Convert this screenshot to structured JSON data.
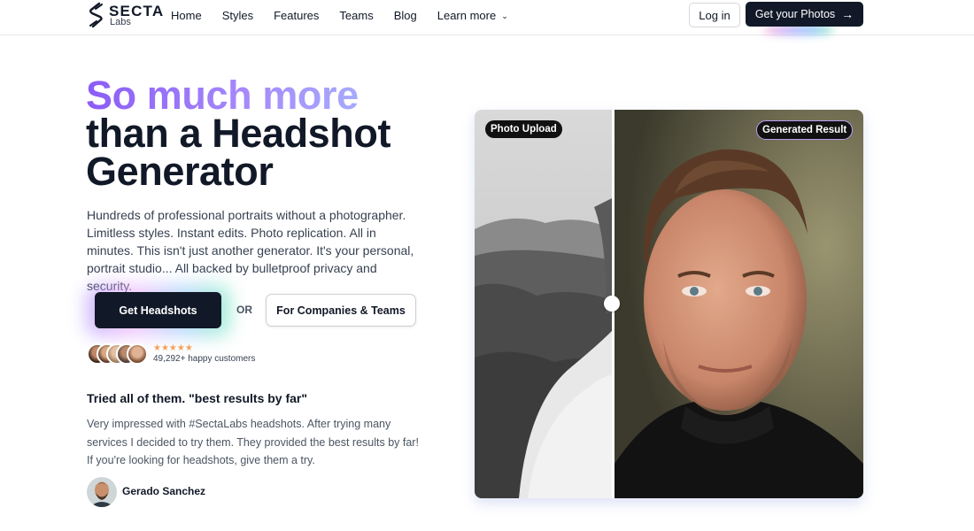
{
  "nav": {
    "brand_main": "SECTA",
    "brand_sub": "Labs",
    "links": [
      "Home",
      "Styles",
      "Features",
      "Teams",
      "Blog",
      "Learn more"
    ],
    "login_label": "Log in",
    "cta_label": "Get your Photos"
  },
  "hero": {
    "headline_gradient": "So much more",
    "headline_line2": "than a Headshot",
    "headline_line3": "Generator",
    "subcopy": "Hundreds of professional portraits without a photographer. Limitless styles. Instant edits. Photo replication. All in minutes. This isn't just another generator. It's your personal, portrait studio... All backed by bulletproof privacy and security.",
    "primary_cta": "Get Headshots",
    "or_label": "OR",
    "secondary_cta": "For Companies & Teams",
    "stars": "★★★★★",
    "customers": "49,292+ happy customers"
  },
  "review": {
    "title": "Tried all of them. \"best results by far\"",
    "body": "Very impressed with #SectaLabs headshots. After trying many services I decided to try them. They provided the best results by far! If you're looking for headshots, give them a try.",
    "author": "Gerado Sanchez"
  },
  "comparison": {
    "left_label": "Photo Upload",
    "right_label": "Generated Result"
  },
  "colors": {
    "accent_purple": "#8b5cf6",
    "dark": "#111827",
    "star": "#f5a05a"
  }
}
